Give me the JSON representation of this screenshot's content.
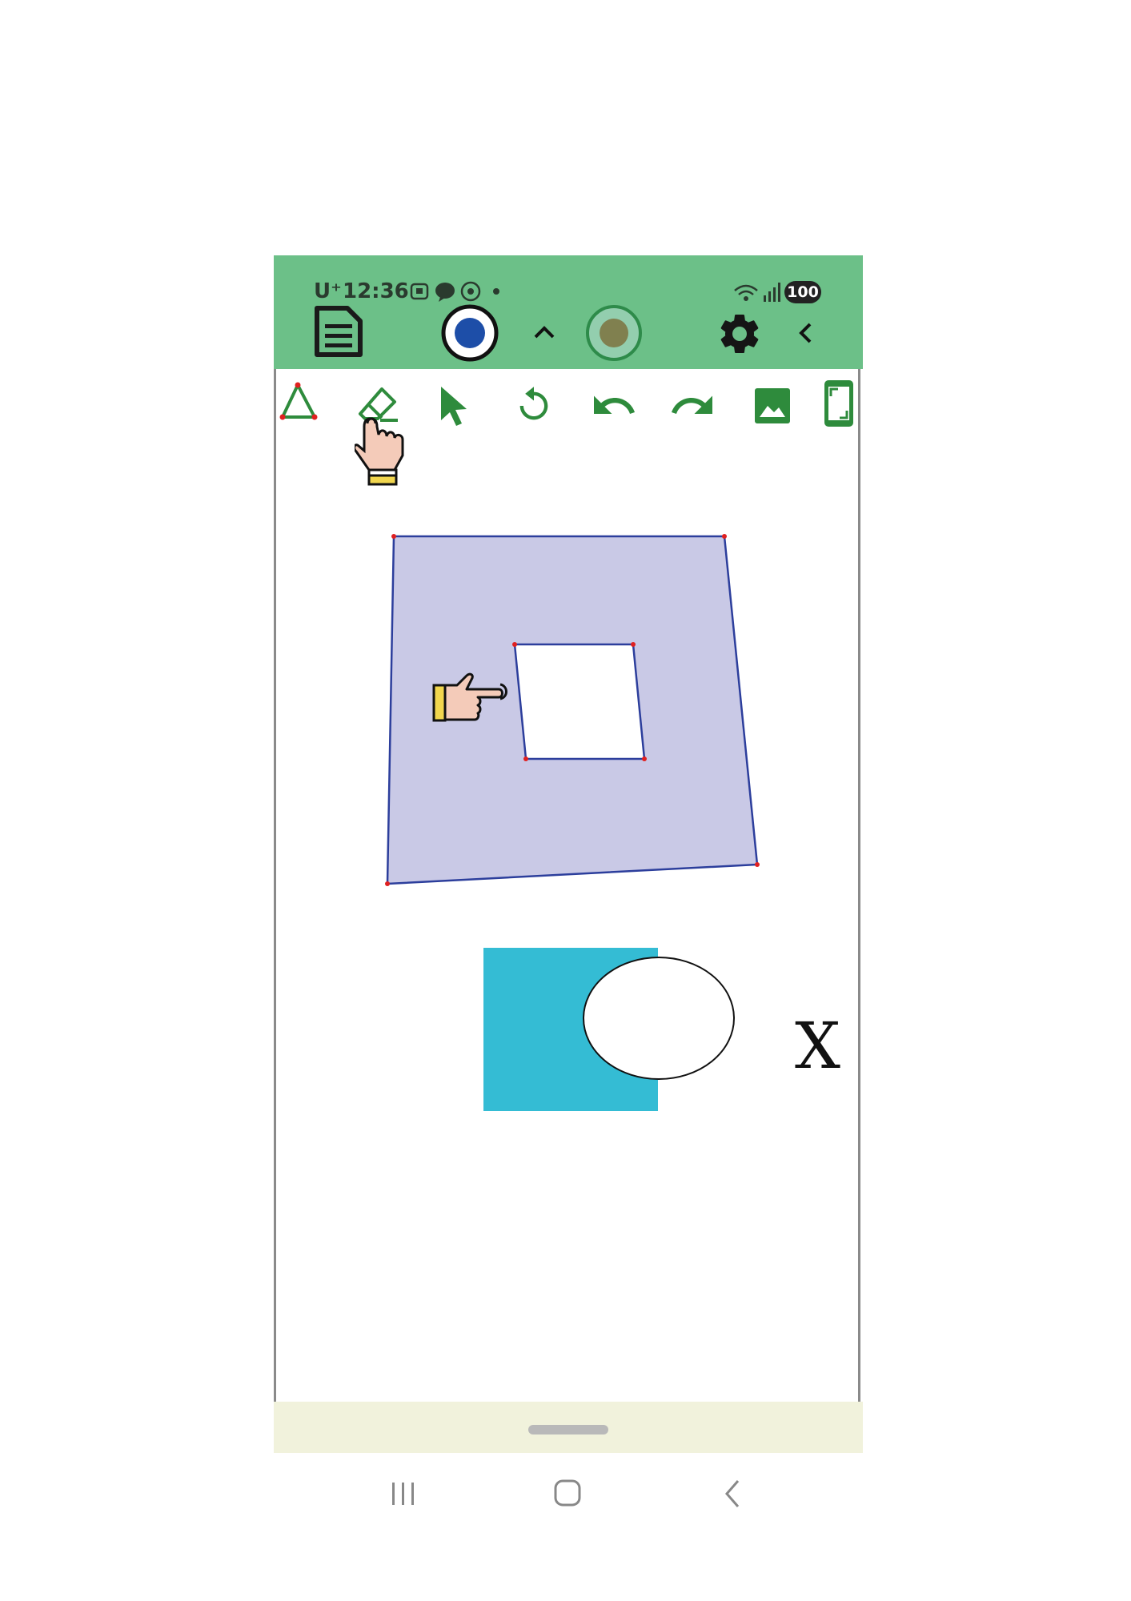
{
  "status_bar": {
    "carrier": "U⁺",
    "time": "12:36",
    "battery": "100"
  },
  "app_bar": {
    "icons": [
      "document-icon",
      "record-dot-icon",
      "chevron-up-icon",
      "olive-color-icon",
      "gear-icon",
      "back-chevron-icon"
    ]
  },
  "toolbar": {
    "tools": [
      "polygon-tool-icon",
      "eraser-tool-icon",
      "select-arrow-icon",
      "rotate-icon",
      "undo-icon",
      "redo-icon",
      "image-icon",
      "fullscreen-icon"
    ]
  },
  "canvas": {
    "label": "X"
  },
  "colors": {
    "status_bar": "#6cc088",
    "accent_green": "#2e8b3c",
    "polygon_fill": "#c9c9e6",
    "polygon_stroke": "#2c3e9c",
    "vertex": "#e02020",
    "cyan_rect": "#34bcd4",
    "handle_bar": "#f1f2dc"
  }
}
